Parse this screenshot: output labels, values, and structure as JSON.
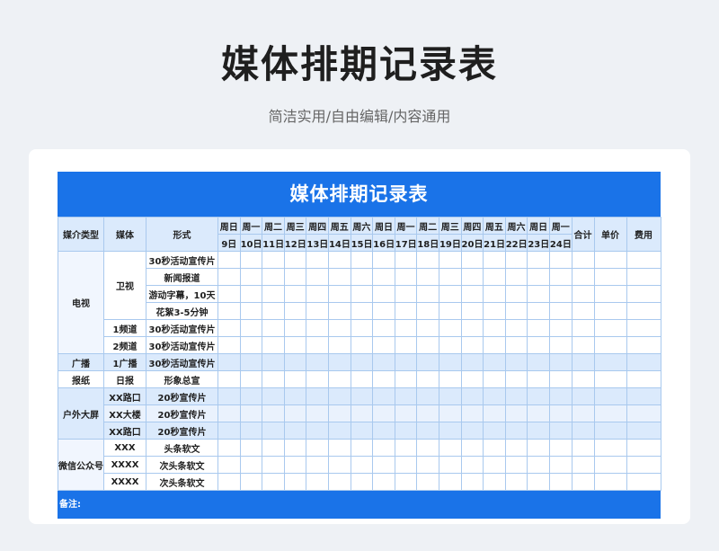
{
  "header": {
    "title": "媒体排期记录表",
    "subtitle": "简洁实用/自由编辑/内容通用"
  },
  "sheet": {
    "title": "媒体排期记录表",
    "columns": {
      "media_type": "媒介类型",
      "media": "媒体",
      "form": "形式",
      "total": "合计",
      "unit_price": "单价",
      "cost": "费用"
    },
    "weekdays": [
      "周日",
      "周一",
      "周二",
      "周三",
      "周四",
      "周五",
      "周六",
      "周日",
      "周一",
      "周二",
      "周三",
      "周四",
      "周五",
      "周六",
      "周日",
      "周一"
    ],
    "dates": [
      "9日",
      "10日",
      "11日",
      "12日",
      "13日",
      "14日",
      "15日",
      "16日",
      "17日",
      "18日",
      "19日",
      "20日",
      "21日",
      "22日",
      "23日",
      "24日"
    ],
    "categories": [
      {
        "name": "电视",
        "groups": [
          {
            "media": "卫视",
            "forms": [
              "30秒活动宣传片",
              "新闻报道",
              "游动字幕，10天",
              "花絮3-5分钟"
            ]
          },
          {
            "media": "1频道",
            "forms": [
              "30秒活动宣传片"
            ]
          },
          {
            "media": "2频道",
            "forms": [
              "30秒活动宣传片"
            ]
          }
        ]
      },
      {
        "name": "广播",
        "groups": [
          {
            "media": "1广播",
            "forms": [
              "30秒活动宣传片"
            ]
          }
        ]
      },
      {
        "name": "报纸",
        "groups": [
          {
            "media": "日报",
            "forms": [
              "形象总宣"
            ]
          }
        ]
      },
      {
        "name": "户外大屏",
        "groups": [
          {
            "media": "XX路口",
            "forms": [
              "20秒宣传片"
            ]
          },
          {
            "media": "XX大楼",
            "forms": [
              "20秒宣传片"
            ]
          },
          {
            "media": "XX路口",
            "forms": [
              "20秒宣传片"
            ]
          }
        ]
      },
      {
        "name": "微信公众号",
        "groups": [
          {
            "media": "XXX",
            "forms": [
              "头条软文"
            ]
          },
          {
            "media": "XXXX",
            "forms": [
              "次头条软文"
            ]
          },
          {
            "media": "XXXX",
            "forms": [
              "次头条软文"
            ]
          }
        ]
      }
    ],
    "footer_note": "备注:"
  },
  "colors": {
    "accent": "#1a73e8",
    "header_fill": "#dbeafc",
    "border": "#a9c9ee"
  }
}
